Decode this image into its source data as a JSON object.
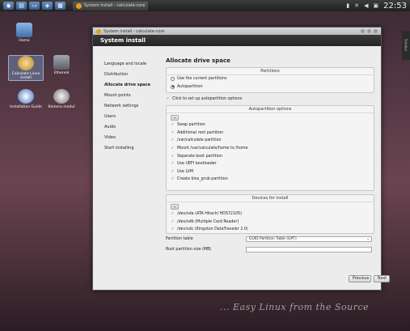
{
  "panel": {
    "task_title": "System install - calculate-core",
    "clock": "22:53"
  },
  "desktop": {
    "icons": [
      {
        "label": "Home"
      },
      {
        "label": "Calculate Linux Install"
      },
      {
        "label": "Ethereal"
      },
      {
        "label": "Installation Guide"
      },
      {
        "label": "Kamera modul"
      }
    ],
    "right_strip_label": "Sidebar"
  },
  "window": {
    "title": "System install - calculate-core",
    "header": "System install"
  },
  "sidebar": {
    "items": [
      {
        "label": "Language and locale",
        "active": false
      },
      {
        "label": "Distribution",
        "active": false
      },
      {
        "label": "Allocate drive space",
        "active": true
      },
      {
        "label": "Mount points",
        "active": false
      },
      {
        "label": "Network settings",
        "active": false
      },
      {
        "label": "Users",
        "active": false
      },
      {
        "label": "Audio",
        "active": false
      },
      {
        "label": "Video",
        "active": false
      },
      {
        "label": "Start installing",
        "active": false
      }
    ]
  },
  "content": {
    "heading": "Allocate drive space",
    "partitions": {
      "title": "Partitions",
      "use_current": "Use the current partitions",
      "autopartition": "Autopartition"
    },
    "autopart_checkbox": "Click to set up autopartition options",
    "autopart_options": {
      "title": "Autopartition options",
      "tool_btn": "+",
      "options": [
        "Swap partition",
        "Additional root partition",
        "/var/calculate partition",
        "Mount /var/calculate/home to /home",
        "Separate boot partition",
        "Use UEFI bootloader",
        "Use LVM",
        "Create bios_grub partition"
      ]
    },
    "devices": {
      "title": "Devices for install",
      "tool_btn": "+",
      "items": [
        "/dev/sda (ATA Hitachi HDS72105)",
        "/dev/sdb (Multiple Card Reader)",
        "/dev/sdc (Kingston DataTraveler 2.0)"
      ]
    },
    "partition_table_label": "Partition table",
    "partition_table_value": "GUID Partition Table (GPT)",
    "root_size_label": "Root partition size (MB)",
    "root_size_value": ""
  },
  "buttons": {
    "previous": "Previous",
    "next": "Next"
  },
  "slogan": "... Easy Linux from the Source"
}
